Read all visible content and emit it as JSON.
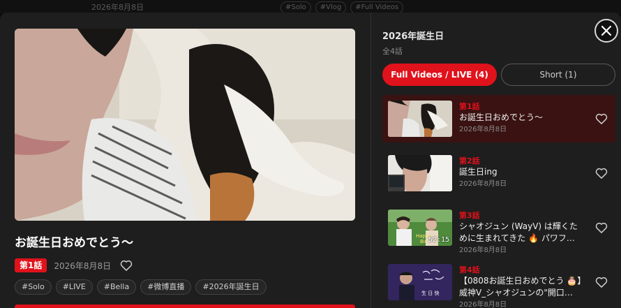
{
  "background": {
    "date": "2026年8月8日",
    "tags": [
      "#Solo",
      "#Vlog",
      "#Full Videos"
    ]
  },
  "player": {
    "title": "お誕生日おめでとう～",
    "episode_badge": "第1話",
    "date": "2026年8月8日",
    "tags": [
      "#Solo",
      "#LIVE",
      "#Bella",
      "#微博直播",
      "#2026年誕生日"
    ]
  },
  "playlist": {
    "title": "2026年誕生日",
    "count": "全4話",
    "tabs": [
      {
        "label": "Full Videos / LIVE (4)",
        "active": true
      },
      {
        "label": "Short (1)",
        "active": false
      }
    ],
    "items": [
      {
        "episode": "第1話",
        "title": "お誕生日おめでとう～",
        "date": "2026年8月8日",
        "duration": ""
      },
      {
        "episode": "第2話",
        "title": "誕生日ing",
        "date": "2026年8月8日",
        "duration": ""
      },
      {
        "episode": "第3話",
        "title": "シャオジュン (WayV) は輝くために生まれてきた 🔥 パワフ…",
        "date": "2026年8月8日",
        "duration": "52:15"
      },
      {
        "episode": "第4話",
        "title": "【0808お誕生日おめでとう 🎂】威神V_シャオジュンの\"開口…",
        "date": "2026年8月8日",
        "duration": ""
      }
    ]
  },
  "colors": {
    "accent": "#e0121b",
    "modal_bg": "#1e1e1e",
    "active_item_bg": "#3a1212"
  },
  "icons": {
    "heart": "heart-outline-icon",
    "close": "close-icon"
  }
}
